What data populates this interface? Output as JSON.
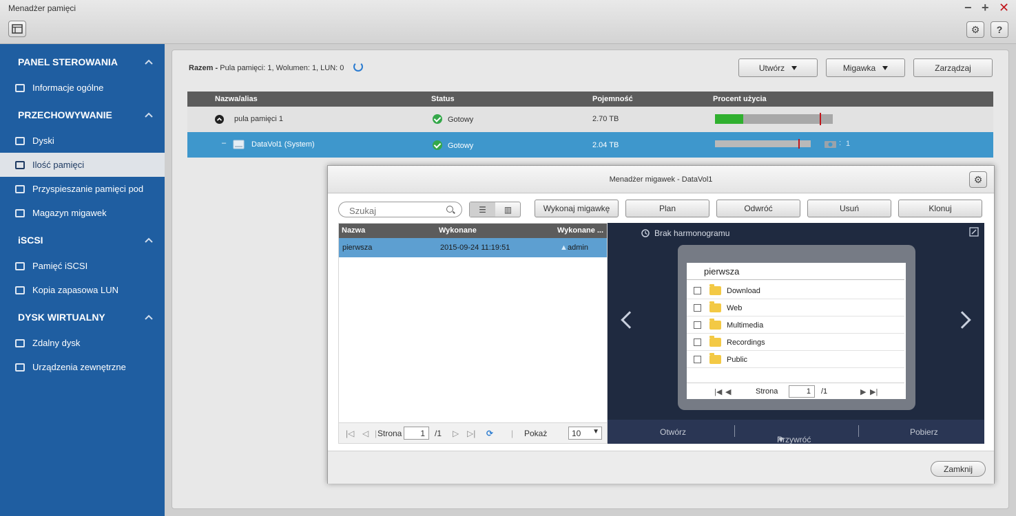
{
  "window": {
    "title": "Menadżer pamięci",
    "controls": [
      "−",
      "+",
      "✕"
    ],
    "help_label": "?"
  },
  "sidebar": {
    "sections": [
      {
        "label": "PANEL STEROWANIA",
        "items": [
          {
            "label": "Informacje ogólne",
            "icon": "info-list-icon"
          }
        ]
      },
      {
        "label": "PRZECHOWYWANIE",
        "items": [
          {
            "label": "Dyski",
            "icon": "disk-icon"
          },
          {
            "label": "Ilość pamięci",
            "icon": "storage-icon",
            "active": true
          },
          {
            "label": "Przyspieszanie pamięci pod",
            "icon": "cache-icon"
          },
          {
            "label": "Magazyn migawek",
            "icon": "snapshot-vault-icon"
          }
        ]
      },
      {
        "label": "iSCSI",
        "items": [
          {
            "label": "Pamięć iSCSI",
            "icon": "iscsi-icon"
          },
          {
            "label": "Kopia zapasowa LUN",
            "icon": "lun-backup-icon"
          }
        ]
      },
      {
        "label": "DYSK WIRTUALNY",
        "items": [
          {
            "label": "Zdalny dysk",
            "icon": "remote-disk-icon"
          },
          {
            "label": "Urządzenia zewnętrzne",
            "icon": "external-device-icon"
          }
        ]
      }
    ]
  },
  "summary": {
    "label": "Razem -",
    "text": "Pula pamięci: 1, Wolumen: 1, LUN: 0"
  },
  "toolbar": {
    "create_label": "Utwórz",
    "snapshot_label": "Migawka",
    "manage_label": "Zarządzaj"
  },
  "pool_table": {
    "columns": [
      "Nazwa/alias",
      "Status",
      "Pojemność",
      "Procent użycia"
    ],
    "rows": [
      {
        "name": "pula pamięci 1",
        "status": "Gotowy",
        "capacity": "2.70 TB",
        "usage_fill": 0.24,
        "threshold": 0.89
      },
      {
        "name": "DataVol1 (System)",
        "status": "Gotowy",
        "capacity": "2.04 TB",
        "usage_fill": 0.0,
        "threshold": 0.87,
        "snapshot_count": "1",
        "snapshot_sep": ":"
      }
    ]
  },
  "dialog": {
    "title": "Menadżer migawek - DataVol1",
    "search_placeholder": "Szukaj",
    "buttons": [
      "Wykonaj migawkę",
      "Plan",
      "Odwróć",
      "Usuń",
      "Klonuj"
    ],
    "list_columns": [
      "Nazwa",
      "Wykonane",
      "Wykonane ..."
    ],
    "snapshots": [
      {
        "name": "pierwsza",
        "taken": "2015-09-24 11:19:51",
        "by": "admin"
      }
    ],
    "pager": {
      "page_label": "Strona",
      "page": "1",
      "total": "/1",
      "show_label": "Pokaż",
      "page_size": "10"
    },
    "preview": {
      "schedule": "Brak harmonogramu",
      "folder_title": "pierwsza",
      "folders": [
        "Download",
        "Web",
        "Multimedia",
        "Recordings",
        "Public"
      ],
      "pager": {
        "page_label": "Strona",
        "page": "1",
        "total": "/1"
      },
      "actions": {
        "open": "Otwórz",
        "restore": "Przywróć",
        "download": "Pobierz"
      }
    },
    "close_label": "Zamknij"
  }
}
